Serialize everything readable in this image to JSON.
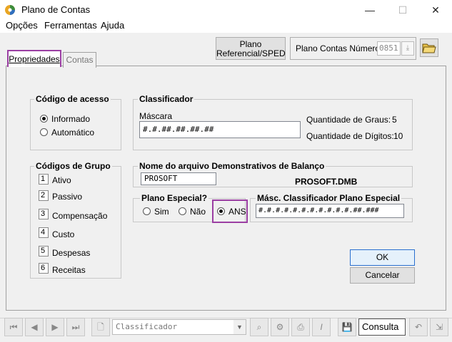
{
  "window": {
    "title": "Plano de Contas",
    "minimize": "—",
    "maximize": "☐",
    "close": "✕"
  },
  "menu": [
    "Opções",
    "Ferramentas",
    "Ajuda"
  ],
  "tabs": {
    "active": "Propriedades",
    "other": "Contas"
  },
  "header": {
    "plano_button_line1": "Plano",
    "plano_button_line2": "Referencial/SPED",
    "plano_numero_label": "Plano Contas Número",
    "plano_numero_value": "0851"
  },
  "codigo_acesso": {
    "title": "Código de acesso",
    "options": [
      "Informado",
      "Automático"
    ],
    "selected": "Informado"
  },
  "classificador": {
    "title": "Classificador",
    "mascara_label": "Máscara",
    "mascara_value": "#.#.##.##.##.##",
    "graus_label": "Quantidade de Graus:",
    "graus_value": "5",
    "digitos_label": "Quantidade de Dígitos:",
    "digitos_value": "10"
  },
  "codigos_grupo": {
    "title": "Códigos de Grupo",
    "items": [
      {
        "num": "1",
        "label": "Ativo"
      },
      {
        "num": "2",
        "label": "Passivo"
      },
      {
        "num": "3",
        "label": "Compensação"
      },
      {
        "num": "4",
        "label": "Custo"
      },
      {
        "num": "5",
        "label": "Despesas"
      },
      {
        "num": "6",
        "label": "Receitas"
      }
    ]
  },
  "demonstrativos": {
    "title": "Nome do arquivo Demonstrativos de Balanço",
    "value": "PROSOFT",
    "file": "PROSOFT.DMB"
  },
  "plano_especial": {
    "title": "Plano Especial?",
    "options": [
      "Sim",
      "Não",
      "ANS"
    ],
    "selected": "ANS"
  },
  "masc_especial": {
    "title": "Másc. Classificador Plano Especial",
    "value": "#.#.#.#.#.#.#.#.#.#.#.##.###"
  },
  "buttons": {
    "ok": "OK",
    "cancel": "Cancelar"
  },
  "toolbar": {
    "combo": "Classificador",
    "mode": "Consulta"
  },
  "colors": {
    "highlight": "#9b3fa3"
  }
}
